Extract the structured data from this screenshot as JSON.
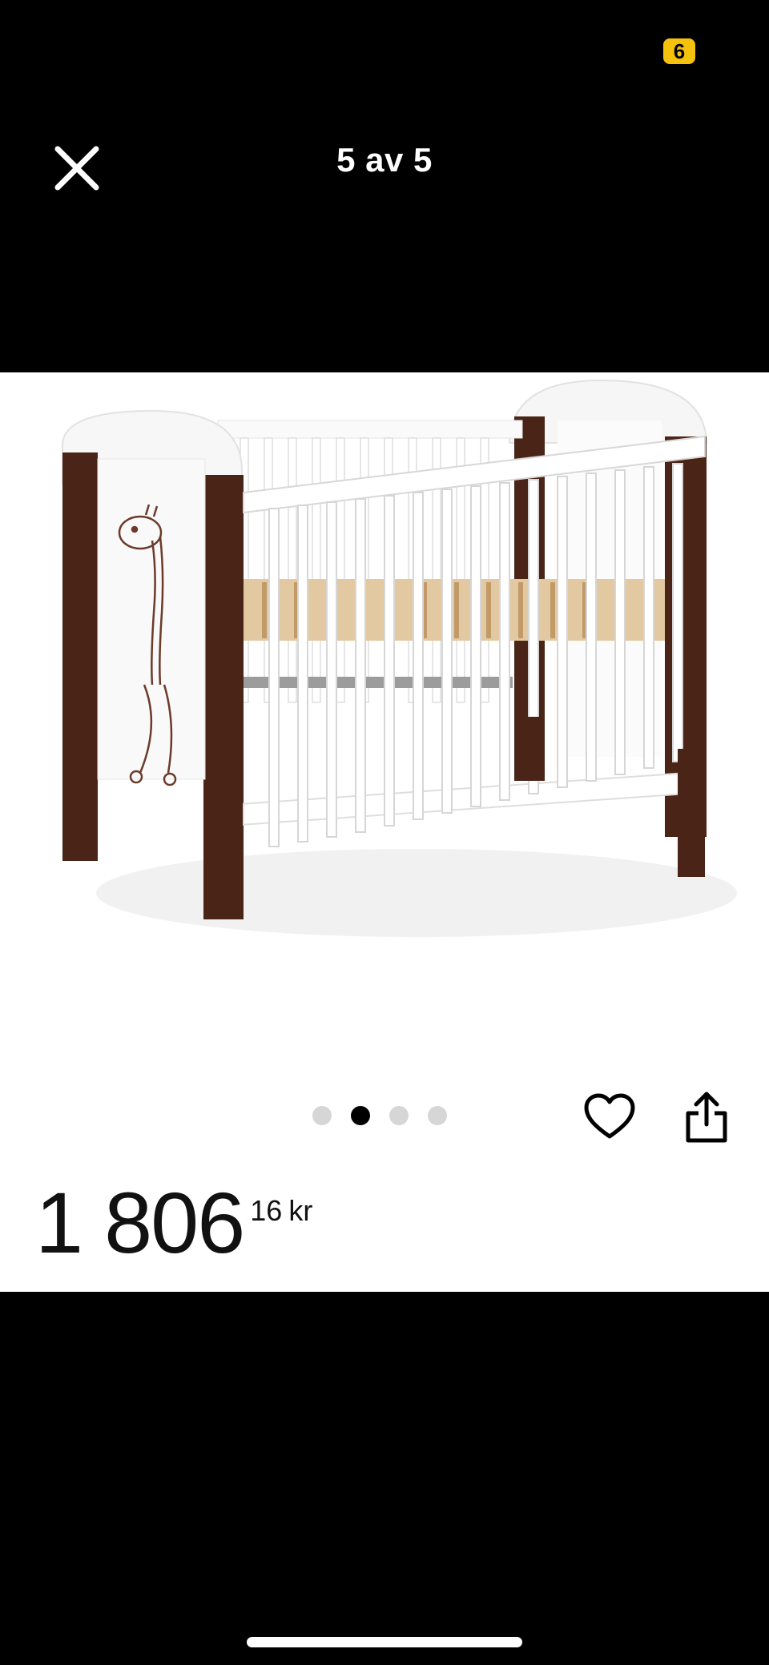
{
  "status_bar": {
    "battery_badge": "6"
  },
  "header": {
    "title": "5 av 5",
    "close_icon": "close-icon"
  },
  "gallery": {
    "dot_count": 4,
    "active_index": 1,
    "image": "baby-crib-product-photo"
  },
  "actions": {
    "favorite_icon": "heart-icon",
    "share_icon": "share-icon"
  },
  "price": {
    "integer": "1 806",
    "decimals": "16",
    "currency": "kr"
  },
  "colors": {
    "background": "#000000",
    "panel": "#ffffff",
    "badge": "#f4c20d",
    "crib_wood": "#4a2517"
  }
}
